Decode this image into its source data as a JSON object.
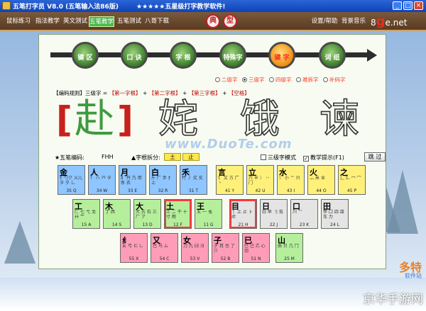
{
  "window": {
    "title": "五笔打字员 V8.0 (五笔输入法86版)",
    "slogan": "★★★★★五星级打字教学软件!"
  },
  "menu": {
    "items": [
      {
        "label": "鼠标练习"
      },
      {
        "label": "指法教学"
      },
      {
        "label": "英文测试"
      },
      {
        "label": "五笔教学"
      },
      {
        "label": "五笔测试"
      },
      {
        "label": "八哥下载"
      }
    ],
    "badges": [
      "典",
      "型"
    ],
    "right_items": [
      {
        "label": "设置/帮助"
      },
      {
        "label": "背景音乐"
      }
    ],
    "logo_prefix": "8",
    "logo_big": "g",
    "logo_suffix": "e.net"
  },
  "nav": {
    "buttons": [
      {
        "label": "键 区"
      },
      {
        "label": "口 诀"
      },
      {
        "label": "字 根"
      },
      {
        "label": "特殊字"
      },
      {
        "label": "键 字"
      },
      {
        "label": "词 组"
      }
    ]
  },
  "radios": [
    {
      "label": "二级字"
    },
    {
      "label": "三级字"
    },
    {
      "label": "四级字"
    },
    {
      "label": "难拆字"
    },
    {
      "label": "补码字"
    }
  ],
  "rule": {
    "prefix": "【编码规则】三级字 = ",
    "parts": [
      "【第一字根】",
      "【第二字根】",
      "【第三字根】",
      "【空格】"
    ],
    "joiners": [
      " + ",
      " + ",
      " + "
    ]
  },
  "practice": {
    "chars": [
      "赴",
      "姹",
      "饿",
      "谏"
    ],
    "open_bracket": "[",
    "close_bracket": "]"
  },
  "info": {
    "code_label": "★五笔编码:",
    "code_value": "FHH",
    "stroke_label": "▲字根拆分:",
    "stroke_box_1": "土",
    "stroke_box_2": "止",
    "mode_label": "三级字模式",
    "hint_label": "教学提示(F1)",
    "hint_check_mark": "✓",
    "skip_label": "跳 过"
  },
  "watermark": "www.DuoTe.com",
  "keyboard": {
    "rows": [
      [
        {
          "ch": "金",
          "rad": "钅勺ク 乂儿タ 夕 乚",
          "code": "35 Q",
          "zone": "z-blue"
        },
        {
          "ch": "人",
          "rad": "亻 八 癶 タ",
          "code": "34 W",
          "zone": "z-blue"
        },
        {
          "ch": "月",
          "rad": "⺼ 丹 乃 用 豕 衣",
          "code": "33 E",
          "zone": "z-blue"
        },
        {
          "ch": "白",
          "rad": "斤 厂 手 扌 上",
          "code": "32 R",
          "zone": "z-blue"
        },
        {
          "ch": "禾",
          "rad": "竹 丿 攵 夂",
          "code": "31 T",
          "zone": "z-blue"
        },
        {
          "ch": "言",
          "rad": "讠 文 方 广 丶",
          "code": "41 Y",
          "zone": "z-yellow"
        },
        {
          "ch": "立",
          "rad": "六 辛 冫 丷 门",
          "code": "42 U",
          "zone": "z-yellow"
        },
        {
          "ch": "水",
          "rad": "氵 小 ⺌ 兴",
          "code": "43 I",
          "zone": "z-yellow"
        },
        {
          "ch": "火",
          "rad": "灬 米 业",
          "code": "44 O",
          "zone": "z-yellow"
        },
        {
          "ch": "之",
          "rad": "辶 廴 冖 宀",
          "code": "45 P",
          "zone": "z-yellow"
        }
      ],
      [
        {
          "ch": "工",
          "rad": "匚 七 弋 戈 廾 艹",
          "code": "15 A",
          "zone": "z-green"
        },
        {
          "ch": "木",
          "rad": "丁 西",
          "code": "14 S",
          "zone": "z-green"
        },
        {
          "ch": "大",
          "rad": "犬 古 石 三 厂 ア",
          "code": "13 D",
          "zone": "z-green"
        },
        {
          "ch": "土",
          "rad": "士 二 干 十 寸 雨",
          "code": "12 F",
          "zone": "z-green",
          "hl": true
        },
        {
          "ch": "王",
          "rad": "五 一 戋",
          "code": "11 G",
          "zone": "z-green"
        },
        {
          "ch": "目",
          "rad": "丨 上 止 卜 虍",
          "code": "21 H",
          "zone": "z-gray",
          "hl": true
        },
        {
          "ch": "日",
          "rad": "曰 早 刂 虫",
          "code": "22 J",
          "zone": "z-gray"
        },
        {
          "ch": "口",
          "rad": "川 ⺍",
          "code": "23 K",
          "zone": "z-gray"
        },
        {
          "ch": "田",
          "rad": "甲 囗 四 皿 车 力",
          "code": "24 L",
          "zone": "z-gray"
        }
      ],
      [
        {
          "ch": "纟",
          "rad": "幺 弓 匕 乚",
          "code": "55 X",
          "zone": "z-red"
        },
        {
          "ch": "又",
          "rad": "巴 马 厶",
          "code": "54 C",
          "zone": "z-red"
        },
        {
          "ch": "女",
          "rad": "刀 九 臼 彐",
          "code": "53 V",
          "zone": "z-red"
        },
        {
          "ch": "子",
          "rad": "孑 耳 也 了 卩",
          "code": "52 B",
          "zone": "z-red"
        },
        {
          "ch": "已",
          "rad": "巳 己 乙 心 羽",
          "code": "51 N",
          "zone": "z-red"
        },
        {
          "ch": "山",
          "rad": "由 贝 几 冂",
          "code": "25 M",
          "zone": "z-green"
        }
      ]
    ]
  },
  "corner": {
    "brand": "多特",
    "brand_sub": "软件站",
    "site": "京华手游网"
  }
}
